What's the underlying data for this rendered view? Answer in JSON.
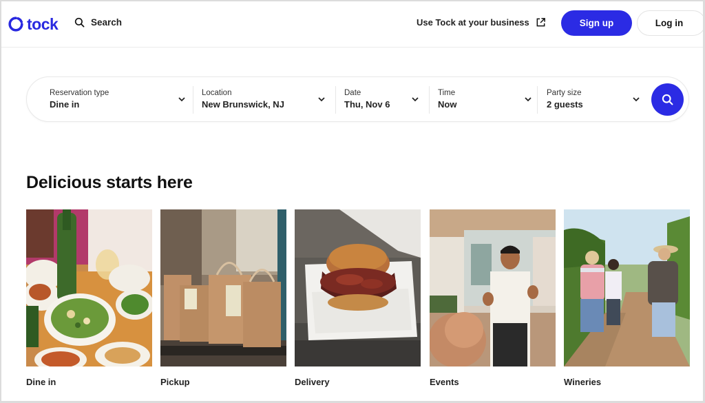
{
  "brand": {
    "name": "tock",
    "color": "#2b2be4"
  },
  "header": {
    "search_label": "Search",
    "business_link": "Use Tock at your business",
    "signup_label": "Sign up",
    "login_label": "Log in"
  },
  "search_bar": {
    "fields": [
      {
        "label": "Reservation type",
        "value": "Dine in"
      },
      {
        "label": "Location",
        "value": "New Brunswick, NJ"
      },
      {
        "label": "Date",
        "value": "Thu, Nov 6"
      },
      {
        "label": "Time",
        "value": "Now"
      },
      {
        "label": "Party size",
        "value": "2 guests"
      }
    ]
  },
  "section": {
    "title": "Delicious starts here",
    "categories": [
      {
        "label": "Dine in",
        "image": "dining-table-photo"
      },
      {
        "label": "Pickup",
        "image": "paper-bags-photo"
      },
      {
        "label": "Delivery",
        "image": "burger-container-photo"
      },
      {
        "label": "Events",
        "image": "chef-presenting-photo"
      },
      {
        "label": "Wineries",
        "image": "vineyard-walk-photo"
      }
    ]
  }
}
